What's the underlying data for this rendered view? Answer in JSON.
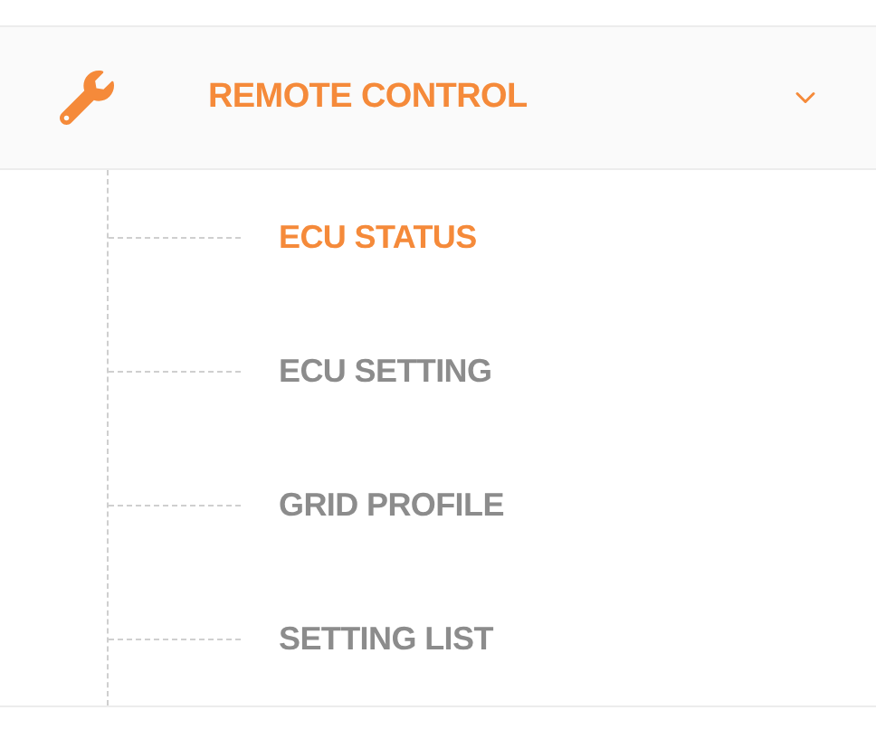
{
  "section": {
    "label": "REMOTE CONTROL",
    "expanded": true,
    "items": [
      {
        "label": "ECU STATUS",
        "selected": true
      },
      {
        "label": "ECU SETTING",
        "selected": false
      },
      {
        "label": "GRID PROFILE",
        "selected": false
      },
      {
        "label": "SETTING LIST",
        "selected": false
      }
    ]
  }
}
